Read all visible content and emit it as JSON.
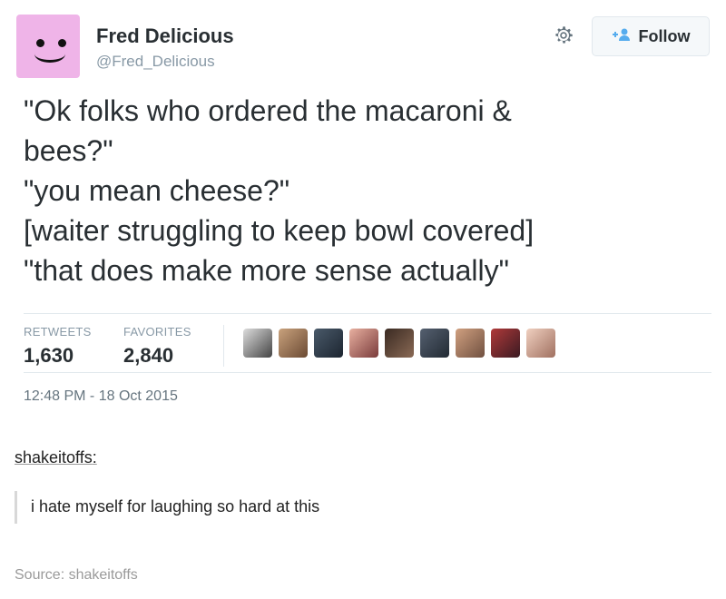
{
  "tweet": {
    "author_name": "Fred Delicious",
    "author_handle": "@Fred_Delicious",
    "follow_label": "Follow",
    "lines": [
      "\"Ok folks who ordered the macaroni &",
      "bees?\"",
      "\"you mean cheese?\"",
      "[waiter struggling to keep bowl covered]",
      "\"that does make more sense actually\""
    ],
    "stats": {
      "retweets_label": "RETWEETS",
      "retweets_value": "1,630",
      "favorites_label": "FAVORITES",
      "favorites_value": "2,840"
    },
    "favoriters_count_shown": 9,
    "timestamp": "12:48 PM - 18 Oct 2015"
  },
  "post": {
    "reblogger": "shakeitoffs",
    "reblogger_colon": ":",
    "comment": "i hate myself for laughing so hard at this",
    "source": "Source: shakeitoffs"
  },
  "icons": {
    "settings": "gear-icon",
    "follow": "add-user-icon"
  },
  "colors": {
    "accent": "#55acee",
    "avatar_bg": "#efb4e8",
    "muted_text": "#8899a6"
  }
}
